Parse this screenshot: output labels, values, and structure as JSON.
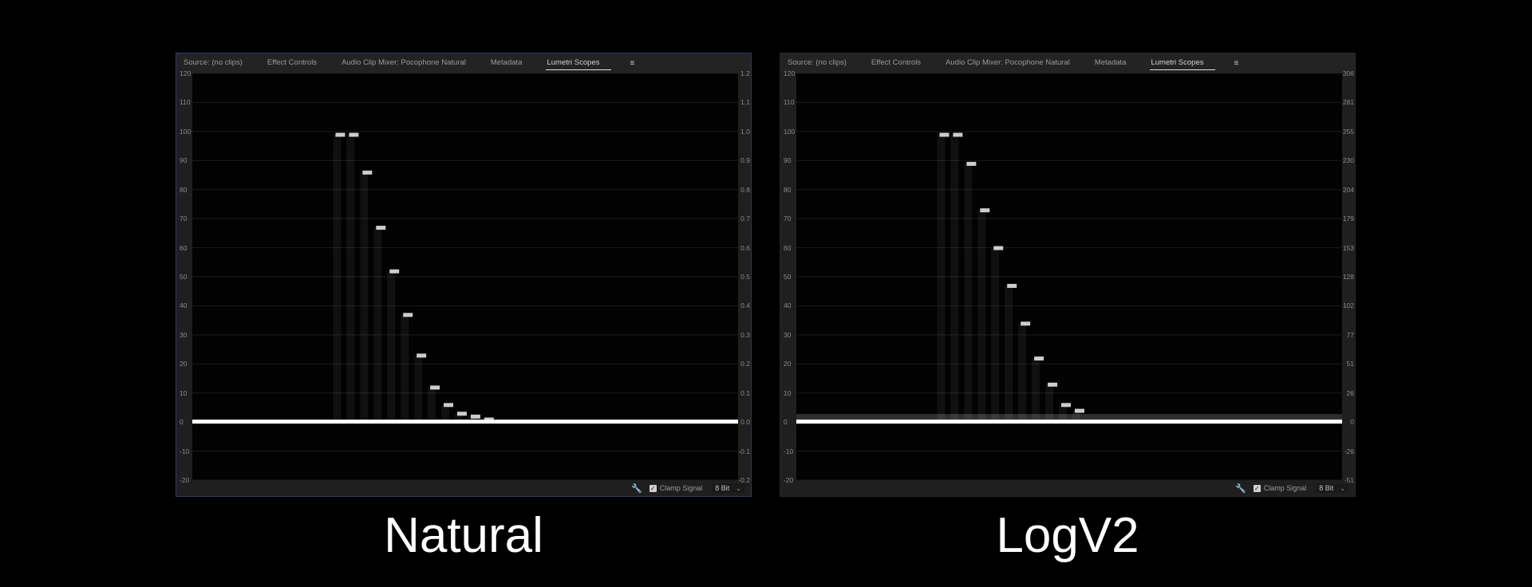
{
  "panels": [
    {
      "tabs": [
        "Source: (no clips)",
        "Effect Controls",
        "Audio Clip Mixer: Pocophone Natural",
        "Metadata",
        "Lumetri Scopes"
      ],
      "active_tab": "Lumetri Scopes",
      "left_axis": [
        "120",
        "110",
        "100",
        "90",
        "80",
        "70",
        "60",
        "50",
        "40",
        "30",
        "20",
        "10",
        "0",
        "-10",
        "-20"
      ],
      "right_axis": [
        "1.2",
        "1.1",
        "1.0",
        "0.9",
        "0.8",
        "0.7",
        "0.6",
        "0.5",
        "0.4",
        "0.3",
        "0.2",
        "0.1",
        "0.0",
        "-0.1",
        "-0.2"
      ],
      "clamp_signal_label": "Clamp Signal",
      "clamp_signal_checked": true,
      "bit_depth": "8 Bit",
      "caption": "Natural"
    },
    {
      "tabs": [
        "Source: (no clips)",
        "Effect Controls",
        "Audio Clip Mixer: Pocophone Natural",
        "Metadata",
        "Lumetri Scopes"
      ],
      "active_tab": "Lumetri Scopes",
      "left_axis": [
        "120",
        "110",
        "100",
        "90",
        "80",
        "70",
        "60",
        "50",
        "40",
        "30",
        "20",
        "10",
        "0",
        "-10",
        "-20"
      ],
      "right_axis": [
        "306",
        "281",
        "255",
        "230",
        "204",
        "179",
        "153",
        "128",
        "102",
        "77",
        "51",
        "26",
        "0",
        "-26",
        "-51"
      ],
      "clamp_signal_label": "Clamp Signal",
      "clamp_signal_checked": true,
      "bit_depth": "8 Bit",
      "caption": "LogV2"
    }
  ],
  "waveforms": [
    {
      "steps": [
        [
          99,
          99
        ],
        [
          86
        ],
        [
          67
        ],
        [
          52
        ],
        [
          37
        ],
        [
          23
        ],
        [
          12
        ],
        [
          6
        ],
        [
          3
        ],
        [
          2
        ],
        [
          1
        ]
      ],
      "baseline": 0
    },
    {
      "steps": [
        [
          99,
          99
        ],
        [
          89
        ],
        [
          73
        ],
        [
          60
        ],
        [
          47
        ],
        [
          34
        ],
        [
          22
        ],
        [
          13
        ],
        [
          6
        ],
        [
          4
        ]
      ],
      "baseline": 0
    }
  ],
  "colors": {
    "background": "#000000",
    "panel": "#1f1f1f",
    "active_border": "#2b3a63",
    "trace": "#ffffff"
  }
}
